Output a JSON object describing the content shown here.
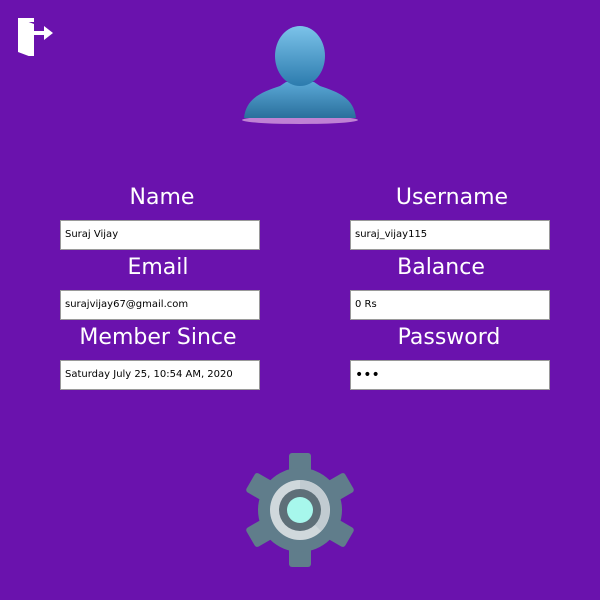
{
  "header": {
    "logout_icon": "logout-door-icon",
    "avatar_icon": "user-avatar-icon"
  },
  "profile": {
    "name_label": "Name",
    "name_value": "Suraj Vijay",
    "username_label": "Username",
    "username_value": "suraj_vijay115",
    "email_label": "Email",
    "email_value": "surajvijay67@gmail.com",
    "balance_label": "Balance",
    "balance_value": "0 Rs",
    "member_since_label": "Member Since",
    "member_since_value": "Saturday July 25, 10:54 AM, 2020",
    "password_label": "Password",
    "password_value": "•••"
  },
  "footer": {
    "settings_icon": "gear-icon"
  },
  "colors": {
    "background": "#6a12ad",
    "avatar": "#3f8fc0",
    "gear": "#607d8b",
    "gear_center": "#a7f7ec"
  }
}
